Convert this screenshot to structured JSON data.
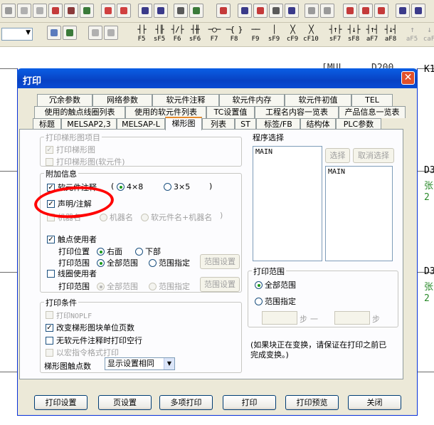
{
  "app": {
    "fkeys_row1": [
      {
        "glyph": "┤├",
        "label": "F5"
      },
      {
        "glyph": "┤╟",
        "label": "sF5"
      },
      {
        "glyph": "┤/├",
        "label": "F6"
      },
      {
        "glyph": "┤╫",
        "label": "sF6"
      },
      {
        "glyph": "─○─",
        "label": "F7"
      },
      {
        "glyph": "─{ }",
        "label": "F8"
      },
      {
        "glyph": "──",
        "label": "F9"
      },
      {
        "glyph": "│",
        "label": "sF9"
      },
      {
        "glyph": "╳",
        "label": "cF9"
      },
      {
        "glyph": "╳",
        "label": "cF10"
      },
      {
        "glyph": "┤↑├",
        "label": "sF7"
      },
      {
        "glyph": "┤↓├",
        "label": "sF8"
      },
      {
        "glyph": "┤↑┤",
        "label": "aF7"
      },
      {
        "glyph": "┤↓┤",
        "label": "aF8"
      },
      {
        "glyph": "↑",
        "label": "aF5"
      },
      {
        "glyph": "↓",
        "label": "caF"
      }
    ],
    "background_text": {
      "mnemonic": "[MUL",
      "device": "D200",
      "k_value": "K1",
      "d1": "D3",
      "g1": "张",
      "n1": "2",
      "d2": "D3",
      "g2": "张",
      "n2": "2"
    }
  },
  "dialog": {
    "title": "打印",
    "close_label": "✕",
    "tabs_row1": [
      "冗余参数",
      "网络参数",
      "软元件注释",
      "软元件内存",
      "软元件初值",
      "TEL"
    ],
    "tabs_row2": [
      "使用的触点线圈列表",
      "使用的软元件列表",
      "TC设置值",
      "工程名内容一览表",
      "产品信息一览表"
    ],
    "tabs_row3": [
      "标题",
      "MELSAP2,3",
      "MELSAP-L",
      "梯形图",
      "列表",
      "ST",
      "标签/FB",
      "结构体",
      "PLC参数"
    ],
    "active_tab": "梯形图",
    "print_items": {
      "legend": "打印梯形图项目",
      "ladder": "打印梯形图",
      "ladder_device": "打印梯形图(软元件)"
    },
    "additional_info": {
      "legend": "附加信息",
      "device_comment": "软元件注释",
      "size_4x8": "4×8",
      "size_3x5": "3×5",
      "paren_close": ")",
      "statement_note": "声明/注解",
      "machine_name_prefix": "机器名",
      "machine_name": "机器名",
      "device_plus_machine": "软元件名+机器名",
      "paren_close2": ")",
      "contact_user": "触点使用者",
      "print_position": "打印位置",
      "right_side": "右面",
      "below": "下部",
      "print_range": "打印范围",
      "all_range": "全部范围",
      "range_specify": "范围指定",
      "range_settings": "范围设置",
      "coil_user": "线圈使用者",
      "print_range2": "打印范围",
      "all_range2": "全部范围",
      "range_specify2": "范围指定",
      "range_settings2": "范围设置"
    },
    "print_conditions": {
      "legend": "打印条件",
      "print_noplf": "打印NOPLF",
      "change_page_units": "改变梯形图块单位页数",
      "no_comment_blank": "无软元件注释时打印空行",
      "macro_format": "以宏指令格式打印",
      "contacts_label": "梯形图触点数",
      "contacts_value": "显示设置相同"
    },
    "program_select": {
      "legend": "程序选择",
      "left_list": [
        "MAIN"
      ],
      "right_list": [
        "MAIN"
      ],
      "select_button": "选择",
      "deselect_button": "取消选择"
    },
    "print_range_group": {
      "legend": "打印范围",
      "all_range": "全部范围",
      "range_specify": "范围指定",
      "step_from": "步",
      "dash": "一",
      "step_to": "步"
    },
    "note": "(如果块正在变换，请保证在打印之前已完成变换。)",
    "buttons": {
      "print_setup": "打印设置",
      "page_setup": "页设置",
      "multi_print": "多项打印",
      "print": "打印",
      "print_preview": "打印预览",
      "close": "关闭"
    }
  },
  "colors": {
    "annotation": "#ff0000",
    "titlebar": "#0a5fe5",
    "background_green": "#2a8a2a"
  }
}
